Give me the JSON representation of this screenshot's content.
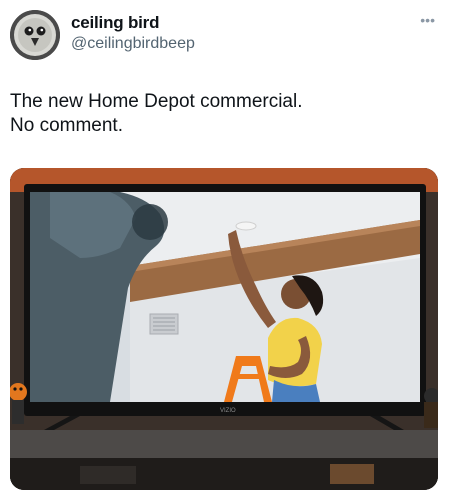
{
  "tweet": {
    "author_name": "ceiling bird",
    "author_handle": "@ceilingbirdbeep",
    "text_line1": "The new Home Depot commercial.",
    "text_line2": "No comment.",
    "more_icon": "ellipsis-icon"
  },
  "media": {
    "tv_brand": "VIZIO"
  },
  "colors": {
    "name": "#0f1419",
    "handle": "#536471",
    "shirt": "#f2d24a",
    "beam": "#9b6a43",
    "ladder": "#f07a1a"
  }
}
